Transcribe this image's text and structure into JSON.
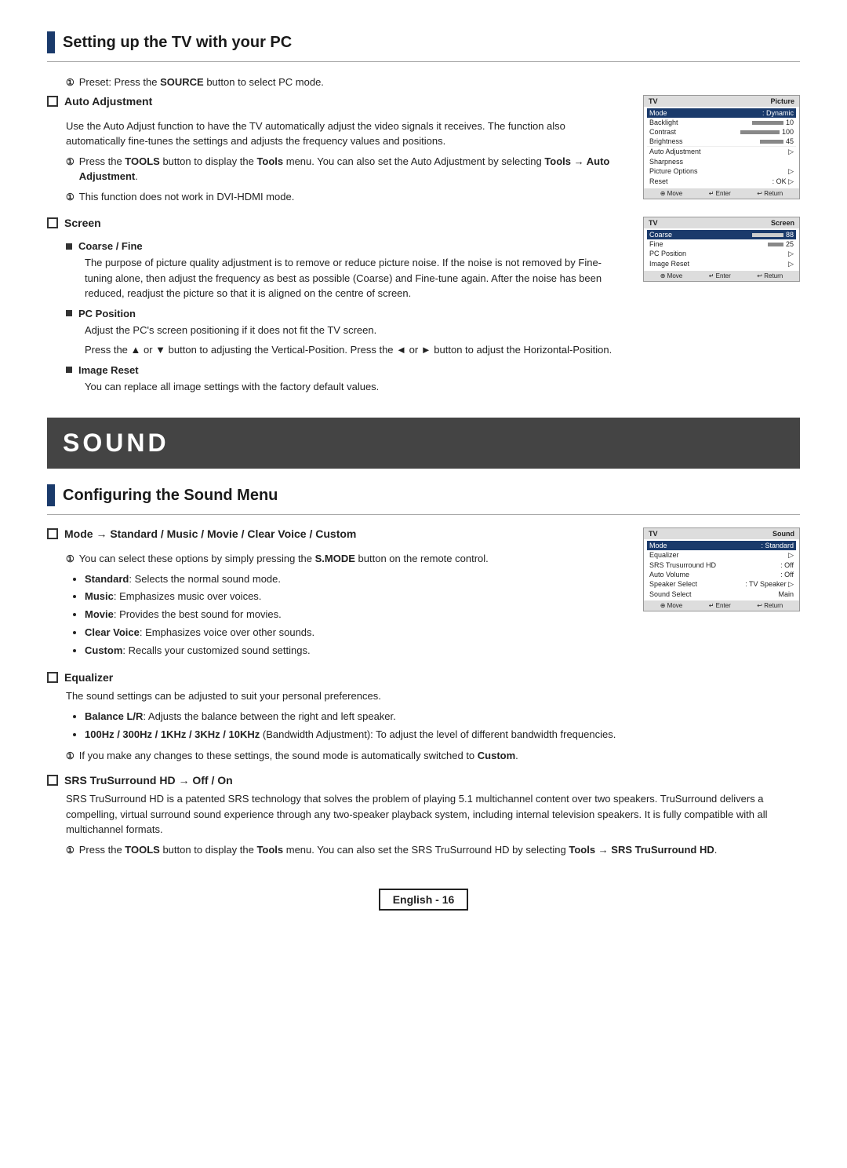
{
  "page": {
    "title": "Setting up the TV with your PC",
    "sound_banner": "SOUND",
    "sound_section_title": "Configuring the Sound Menu",
    "footer_text": "English - 16"
  },
  "pc_section": {
    "preset_note": "Preset: Press the SOURCE button to select PC mode.",
    "auto_adjustment": {
      "title": "Auto Adjustment",
      "desc1": "Use the Auto Adjust function to have the TV automatically adjust the video signals it receives. The function also automatically fine-tunes the settings and adjusts the frequency values and positions.",
      "note1": "Press the TOOLS button to display the Tools menu. You can also set the Auto Adjustment by selecting Tools → Auto Adjustment.",
      "note2": "This function does not work in DVI-HDMI mode."
    },
    "screen": {
      "title": "Screen",
      "coarse_fine": {
        "subtitle": "Coarse / Fine",
        "desc": "The purpose of picture quality adjustment is to remove or reduce picture noise. If the noise is not removed by Fine-tuning alone, then adjust the frequency as best as possible (Coarse) and Fine-tune again. After the noise has been reduced, readjust the picture so that it is aligned on the centre of screen."
      },
      "pc_position": {
        "subtitle": "PC Position",
        "desc1": "Adjust the PC's screen positioning if it does not fit the TV screen.",
        "desc2": "Press the ▲ or ▼ button to adjusting the Vertical-Position. Press the ◄ or ► button to adjust the Horizontal-Position."
      },
      "image_reset": {
        "subtitle": "Image Reset",
        "desc": "You can replace all image settings with the factory default values."
      }
    }
  },
  "sound_section": {
    "mode": {
      "title": "Mode → Standard / Music / Movie / Clear Voice / Custom",
      "note": "You can select these options by simply pressing the S.MODE button on the remote control.",
      "bullets": [
        {
          "text": "Standard: Selects the normal sound mode.",
          "bold_part": "Standard"
        },
        {
          "text": "Music: Emphasizes music over voices.",
          "bold_part": "Music"
        },
        {
          "text": "Movie: Provides the best sound for movies.",
          "bold_part": "Movie"
        },
        {
          "text": "Clear Voice: Emphasizes voice over other sounds.",
          "bold_part": "Clear Voice"
        },
        {
          "text": "Custom: Recalls your customized sound settings.",
          "bold_part": "Custom"
        }
      ]
    },
    "equalizer": {
      "title": "Equalizer",
      "desc": "The sound settings can be adjusted to suit your personal preferences.",
      "bullets": [
        {
          "text": "Balance L/R: Adjusts the balance between the right and left speaker.",
          "bold_part": "Balance L/R"
        },
        {
          "text": "100Hz / 300Hz / 1KHz / 3KHz / 10KHz (Bandwidth Adjustment): To adjust the level of different bandwidth frequencies.",
          "bold_part": "100Hz / 300Hz / 1KHz / 3KHz / 10KHz"
        },
        {
          "text": "If you make any changes to these settings, the sound mode is automatically switched to Custom.",
          "bold_part": "Custom",
          "is_note": true
        }
      ]
    },
    "srs": {
      "title": "SRS TruSurround HD → Off / On",
      "desc1": "SRS TruSurround HD is a patented SRS technology that solves the problem of playing 5.1 multichannel content over two speakers. TruSurround delivers a compelling, virtual surround sound experience through any two-speaker playback system, including internal television speakers. It is fully compatible with all multichannel formats.",
      "note": "Press the TOOLS button to display the Tools menu. You can also set the SRS TruSurround HD by selecting Tools → SRS TruSurround HD."
    }
  },
  "tv_mockup_picture": {
    "title": "TV",
    "panel_title": "Picture",
    "rows": [
      {
        "label": "Mode",
        "value": ": Dynamic",
        "highlight": true
      },
      {
        "label": "Backlight",
        "value": "10",
        "is_bar": true
      },
      {
        "label": "Contrast",
        "value": "100",
        "is_bar": true
      },
      {
        "label": "Brightness",
        "value": "45",
        "is_bar": true
      },
      {
        "label": "Auto Adjustment",
        "value": "",
        "is_arrow": true
      },
      {
        "label": "Sharpness",
        "value": ""
      },
      {
        "label": "Picture Options",
        "value": "",
        "is_arrow": true
      },
      {
        "label": "Reset",
        "value": ": OK",
        "is_arrow": true
      }
    ],
    "footer": [
      "⊕ Move",
      "↵ Enter",
      "↩ Return"
    ]
  },
  "tv_mockup_screen": {
    "title": "TV",
    "panel_title": "Screen",
    "rows": [
      {
        "label": "Coarse",
        "value": "88",
        "is_bar": true,
        "highlight": true
      },
      {
        "label": "Fine",
        "value": "25",
        "is_bar": true
      },
      {
        "label": "PC Position",
        "value": "",
        "is_arrow": true
      },
      {
        "label": "Image Reset",
        "value": "",
        "is_arrow": true
      }
    ],
    "footer": [
      "⊕ Move",
      "↵ Enter",
      "↩ Return"
    ]
  },
  "tv_mockup_sound": {
    "title": "TV",
    "panel_title": "Sound",
    "rows": [
      {
        "label": "Mode",
        "value": ": Standard",
        "highlight": true
      },
      {
        "label": "Equalizer",
        "value": "",
        "is_arrow": true
      },
      {
        "label": "SRS Trusurround HD",
        "value": ": Off"
      },
      {
        "label": "Auto Volume",
        "value": ": Off"
      },
      {
        "label": "Speaker Select",
        "value": ": TV Speaker",
        "is_arrow": true
      },
      {
        "label": "Sound Select",
        "value": "Main"
      }
    ],
    "footer": [
      "⊕ Move",
      "↵ Enter",
      "↩ Return"
    ]
  }
}
